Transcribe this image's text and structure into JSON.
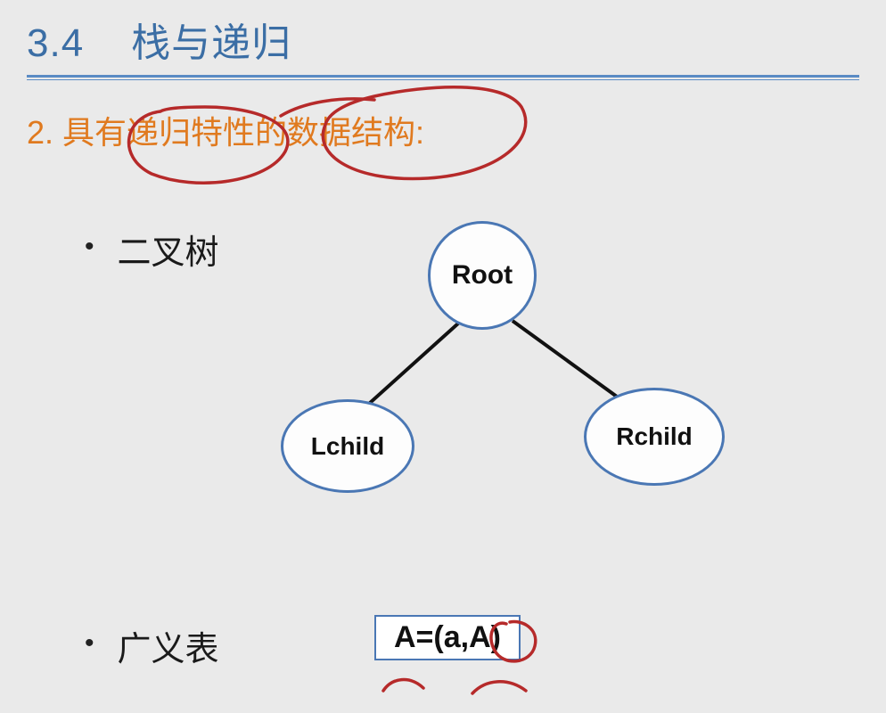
{
  "heading": {
    "number": "3.4",
    "title": "栈与递归"
  },
  "subheading": "2. 具有递归特性的数据结构:",
  "bullets": [
    {
      "label": "二叉树"
    },
    {
      "label": "广义表"
    }
  ],
  "tree": {
    "root": "Root",
    "left": "Lchild",
    "right": "Rchild"
  },
  "generalized_list_formula": "A=(a,A)",
  "colors": {
    "heading": "#3b6ea5",
    "subheading": "#e07a1f",
    "node_border": "#4a77b4",
    "annotation": "#b62a2a"
  }
}
